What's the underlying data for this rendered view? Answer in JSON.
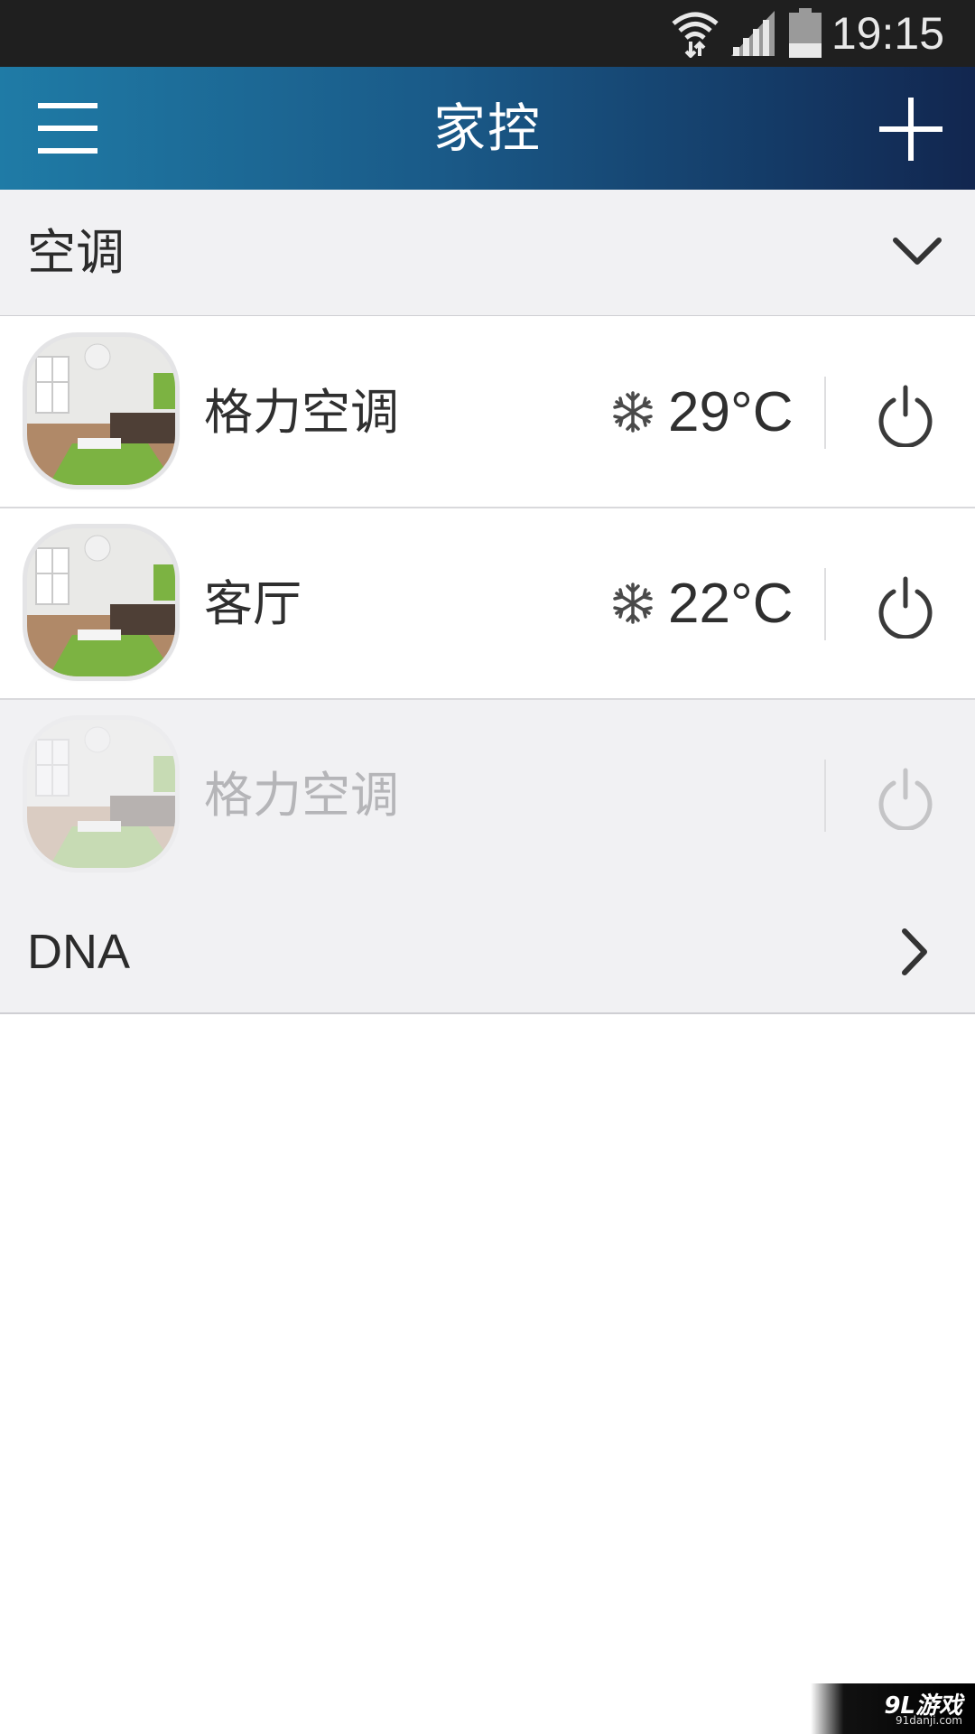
{
  "status_bar": {
    "time": "19:15",
    "icons": [
      "wifi-icon",
      "cell-signal-icon",
      "battery-icon"
    ]
  },
  "header": {
    "title": "家控",
    "left_icon": "menu-icon",
    "right_icon": "plus-icon",
    "gradient_colors": [
      "#1f7ba6",
      "#12264f"
    ]
  },
  "group": {
    "label": "空调",
    "icon": "chevron-down-icon"
  },
  "devices": [
    {
      "name": "格力空调",
      "mode_icon": "snowflake-icon",
      "temperature": "29°C",
      "online": true
    },
    {
      "name": "客厅",
      "mode_icon": "snowflake-icon",
      "temperature": "22°C",
      "online": true
    },
    {
      "name": "格力空调",
      "temperature": "",
      "online": false
    }
  ],
  "dna": {
    "label": "DNA",
    "icon": "chevron-right-icon"
  },
  "watermark": {
    "text": "9L游戏",
    "sub": "91danji.com"
  }
}
